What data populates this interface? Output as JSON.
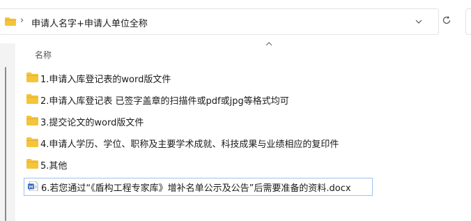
{
  "address": {
    "path_text": "申请人名字+申请人单位全称",
    "separator": "›"
  },
  "columns": {
    "name_header": "名称"
  },
  "files": [
    {
      "label": "1.申请入库登记表的word版文件",
      "type": "folder"
    },
    {
      "label": "2.申请入库登记表 已签字盖章的扫描件或pdf或jpg等格式均可",
      "type": "folder"
    },
    {
      "label": "3.提交论文的word版文件",
      "type": "folder"
    },
    {
      "label": "4.申请人学历、学位、职称及主要学术成就、科技成果与业绩相应的复印件",
      "type": "folder"
    },
    {
      "label": "5.其他",
      "type": "folder"
    },
    {
      "label": "6.若您通过“《盾构工程专家库》增补名单公示及公告”后需要准备的资料.docx",
      "type": "word-document",
      "selected": true
    }
  ],
  "colors": {
    "folder": "#f4c43a",
    "folder_dark": "#e0a82a",
    "word": "#2b5fb4",
    "selection_border": "#9cc3ea"
  }
}
